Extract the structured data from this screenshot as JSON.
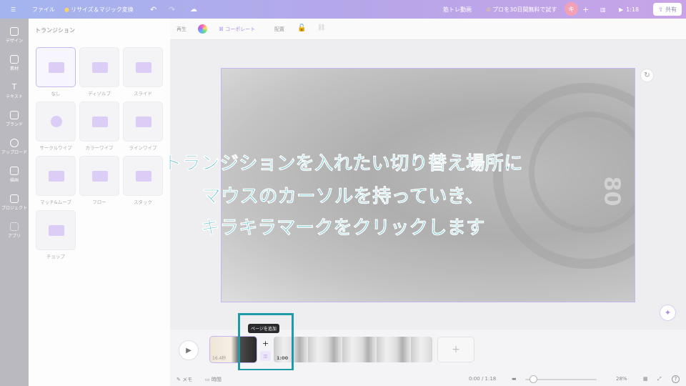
{
  "topbar": {
    "menu_icon": "menu-icon",
    "file": "ファイル",
    "resize": "リサイズ＆マジック変換",
    "title": "筋トレ動画",
    "promo": "プロを30日間無料で試す",
    "avatar": "キ",
    "add": "+",
    "play_time": "1:18",
    "share": "共有"
  },
  "rail": {
    "items": [
      {
        "label": "デザイン",
        "icon": "design-icon"
      },
      {
        "label": "素材",
        "icon": "elements-icon"
      },
      {
        "label": "テキスト",
        "icon": "text-icon"
      },
      {
        "label": "ブランド",
        "icon": "brand-icon"
      },
      {
        "label": "アップロード",
        "icon": "upload-icon"
      },
      {
        "label": "描画",
        "icon": "draw-icon"
      },
      {
        "label": "プロジェクト",
        "icon": "folder-icon"
      },
      {
        "label": "アプリ",
        "icon": "apps-icon"
      }
    ]
  },
  "panel": {
    "title": "トランジション",
    "tiles": [
      {
        "label": "なし",
        "selected": true
      },
      {
        "label": "ディゾルブ"
      },
      {
        "label": "スライド"
      },
      {
        "label": "サークルワイプ"
      },
      {
        "label": "カラーワイプ"
      },
      {
        "label": "ラインワイプ"
      },
      {
        "label": "マッチ&ムーブ"
      },
      {
        "label": "フロー"
      },
      {
        "label": "スタック"
      },
      {
        "label": "チョップ"
      }
    ]
  },
  "context_toolbar": {
    "playback": "再生",
    "collaborate": "コーポレート",
    "position": "配置"
  },
  "caption": {
    "line1": "トランジションを入れたい切り替え場所に",
    "line2": "マウスのカーソルを持っていき、",
    "line3": "キラキラマークをクリックします"
  },
  "canvas": {
    "lens_text": "80"
  },
  "timeline": {
    "clip1_duration": "16.4秒",
    "clip2_duration": "1:00",
    "tooltip": "ページを追加",
    "add_page": "+",
    "add_clip": "+"
  },
  "bottombar": {
    "notes": "メモ",
    "duration": "時間",
    "time": "0:00 / 1:18",
    "zoom": "28%",
    "zoom_level": 0.28
  },
  "colors": {
    "accent": "#8b5cf6",
    "caption": "#3db4c4",
    "highlight": "#1e9aa8"
  }
}
